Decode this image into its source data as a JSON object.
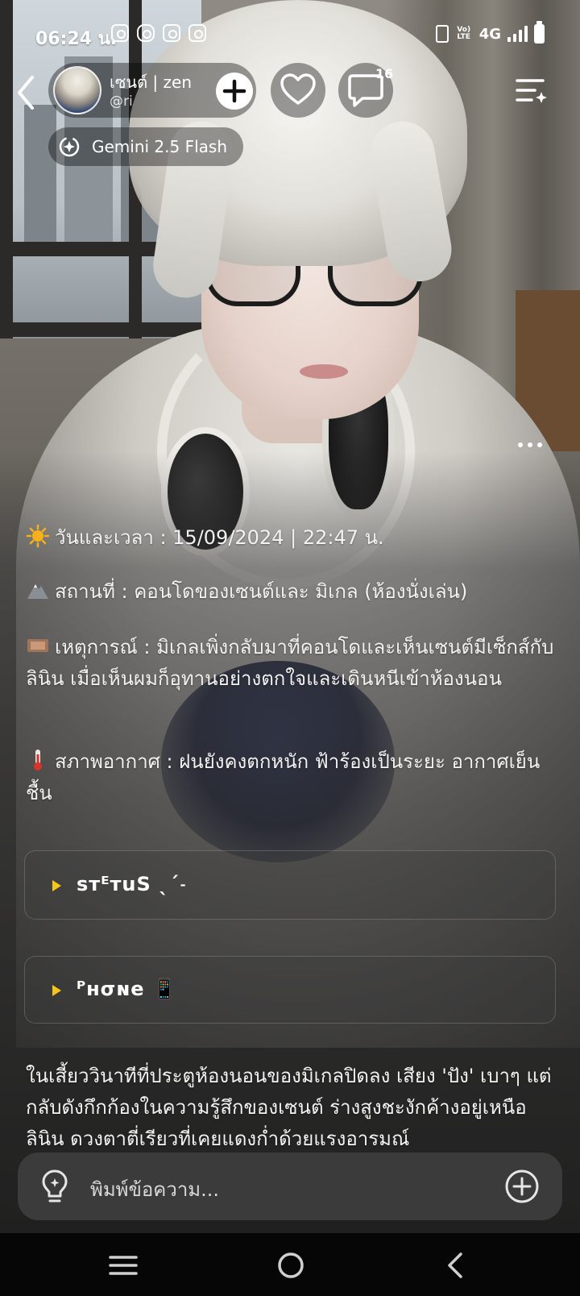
{
  "status_bar": {
    "time": "06:24 น.",
    "app_icons": [
      "instagram-icon",
      "discord-icon",
      "instagram-icon",
      "instagram-icon"
    ],
    "network": "4G",
    "volte": "Vo) LTE",
    "system_icons": [
      "vibrate-icon",
      "volte-icon",
      "signal-icon",
      "battery-icon"
    ]
  },
  "header": {
    "back_icon": "chevron-left-icon",
    "profile": {
      "name": "เซนต์ | zen",
      "handle": "@ri"
    },
    "follow_icon": "plus-icon",
    "like_icon": "heart-icon",
    "comment_icon": "chat-bubble-icon",
    "comment_count": "16",
    "menu_icon": "menu-sparkle-icon",
    "model": {
      "icon": "model-switch-icon",
      "label": "Gemini 2.5 Flash"
    }
  },
  "message": {
    "more_icon": "more-dots-icon",
    "info_lines": [
      {
        "emoji": "sun-emoji",
        "text": "วันและเวลา : 15/09/2024 | 22:47 น."
      },
      {
        "emoji": "mountain-emoji",
        "text": "สถานที่ : คอนโดของเซนต์และ มิเกล (ห้องนั่งเล่น)"
      },
      {
        "emoji": "film-emoji",
        "text": "เหตุการณ์ : มิเกลเพิ่งกลับมาที่คอนโดและเห็นเซนต์มีเซ็กส์กับลินิน เมื่อเห็นผมก็อุทานอย่างตกใจและเดินหนีเข้าห้องนอน"
      },
      {
        "emoji": "thermometer-emoji",
        "text": "สภาพอากาศ : ฝนยังคงตกหนัก ฟ้าร้องเป็นระยะ อากาศเย็นชื้น"
      }
    ],
    "collapsibles": [
      {
        "label": "sᴛᴱᴛuS ˎˊ˗",
        "arrow_color": "#f5c518"
      },
      {
        "label": "ᴾʜσɴe 📱",
        "arrow_color": "#f5c518"
      }
    ],
    "narration": "ในเสี้ยววินาทีที่ประตูห้องนอนของมิเกลปิดลง เสียง 'ปัง' เบาๆ แต่กลับดังกึกก้องในความรู้สึกของเซนต์ ร่างสูงชะงักค้างอยู่เหนือลินิน ดวงตาตี่เรียวที่เคยแดงก่ำด้วยแรงอารมณ์"
  },
  "composer": {
    "bulb_icon": "lightbulb-icon",
    "placeholder": "พิมพ์ข้อความ...",
    "attach_icon": "plus-circle-icon"
  },
  "nav_bar": {
    "recents_icon": "recents-icon",
    "home_icon": "home-icon",
    "back_icon": "back-icon"
  }
}
